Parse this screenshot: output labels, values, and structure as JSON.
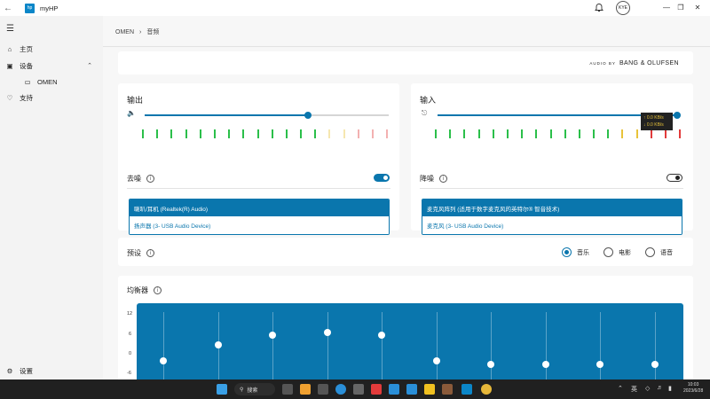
{
  "window": {
    "title": "myHP",
    "account_initials": "KYE"
  },
  "sidebar": {
    "items": [
      {
        "label": "主页",
        "icon": "home-icon"
      },
      {
        "label": "设备",
        "icon": "devices-icon"
      },
      {
        "label": "OMEN",
        "icon": "laptop-icon"
      },
      {
        "label": "支持",
        "icon": "support-icon"
      }
    ],
    "settings_label": "设置"
  },
  "breadcrumb": {
    "parent": "OMEN",
    "current": "音频"
  },
  "brand": {
    "prefix": "AUDIO BY",
    "name": "BANG & OLUFSEN"
  },
  "output": {
    "title": "输出",
    "volume": 0.67,
    "noise_label": "去噪",
    "noise_on": true,
    "devices": [
      "喇叭/耳机 (Realtek(R) Audio)",
      "扬声器 (3- USB Audio Device)"
    ]
  },
  "input": {
    "title": "输入",
    "volume": 1.0,
    "noise_label": "降噪",
    "noise_on": false,
    "devices": [
      "麦克风阵列 (适用于数字麦克风的英特尔® 智音技术)",
      "麦克风 (3- USB Audio Device)"
    ],
    "tooltip_up": "↑ 0.0 KB/s",
    "tooltip_down": "↓ 0.0 KB/s"
  },
  "presets": {
    "label": "预设",
    "options": [
      "音乐",
      "电影",
      "语音"
    ],
    "selected": "音乐"
  },
  "equalizer": {
    "label": "均衡器",
    "axis": [
      "12",
      "6",
      "0",
      "-6"
    ],
    "levels": [
      -2,
      3,
      6,
      7,
      6,
      -2,
      -3,
      -3,
      -3,
      -3
    ]
  },
  "taskbar": {
    "search_label": "搜索",
    "ime": "英",
    "time": "10:03",
    "date": "2023/6/28"
  },
  "colors": {
    "accent": "#0a76ad",
    "green": "#2bbf4a",
    "yellow": "#e8c33a",
    "red": "#e23b3b"
  }
}
